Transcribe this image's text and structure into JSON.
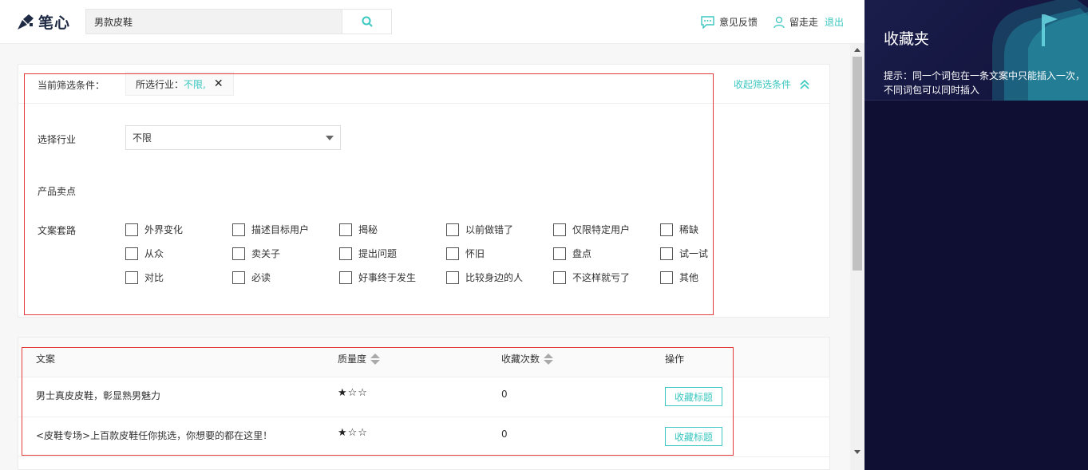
{
  "header": {
    "logo_text": "笔心",
    "search_value": "男款皮鞋",
    "feedback_label": "意见反馈",
    "username": "留走走",
    "logout_label": "退出"
  },
  "filter": {
    "current_label": "当前筛选条件：",
    "chip_key": "所选行业：",
    "chip_value": "不限,",
    "collapse_label": "收起筛选条件",
    "industry_label": "选择行业",
    "industry_value": "不限",
    "selling_point_label": "产品卖点",
    "copy_route_label": "文案套路",
    "options": [
      [
        "外界变化",
        "描述目标用户",
        "揭秘",
        "以前做错了",
        "仅限特定用户",
        "稀缺"
      ],
      [
        "从众",
        "卖关子",
        "提出问题",
        "怀旧",
        "盘点",
        "试一试"
      ],
      [
        "对比",
        "必读",
        "好事终于发生",
        "比较身边的人",
        "不这样就亏了",
        "其他"
      ]
    ]
  },
  "table": {
    "headers": {
      "copy": "文案",
      "quality": "质量度",
      "fav_count": "收藏次数",
      "action": "操作"
    },
    "rows": [
      {
        "copy": "男士真皮皮鞋，彰显熟男魅力",
        "stars": "★☆☆",
        "rating": 1,
        "count": "0",
        "action": "收藏标题"
      },
      {
        "copy": "<皮鞋专场>上百款皮鞋任你挑选，你想要的都在这里！",
        "stars": "★☆☆",
        "rating": 1,
        "count": "0",
        "action": "收藏标题"
      }
    ]
  },
  "favorites": {
    "title": "收藏夹",
    "tip": "提示：同一个词包在一条文案中只能插入一次，不同词包可以同时插入"
  },
  "colors": {
    "accent": "#3cc7c0",
    "panel_bg": "#0e0f33",
    "highlight": "#e03a3a"
  }
}
